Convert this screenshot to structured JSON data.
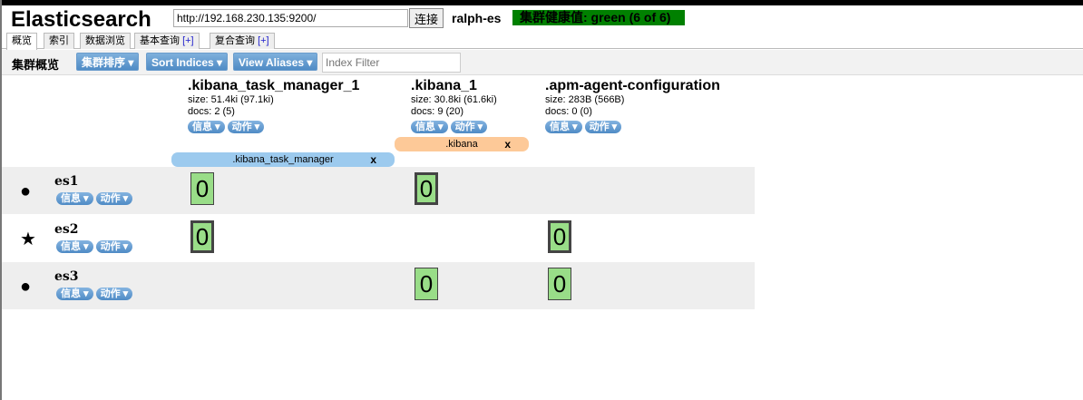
{
  "header": {
    "title": "Elasticsearch",
    "url": "http://192.168.230.135:9200/",
    "connect": "连接",
    "cluster_name": "ralph-es",
    "health": "集群健康值: green (6 of 6)",
    "health_color": "#008000"
  },
  "tabs": [
    {
      "label": "概览",
      "plus": ""
    },
    {
      "label": "索引",
      "plus": ""
    },
    {
      "label": "数据浏览",
      "plus": ""
    },
    {
      "label": "基本查询 ",
      "plus": "[+]"
    },
    {
      "label": "复合查询 ",
      "plus": "[+]"
    }
  ],
  "toolbar": {
    "title": "集群概览",
    "sort_cluster": "集群排序 ▾",
    "sort_indices": "Sort Indices ▾",
    "view_aliases": "View Aliases ▾",
    "filter_placeholder": "Index Filter"
  },
  "buttons": {
    "info": "信息 ▾",
    "action": "动作 ▾"
  },
  "indices": [
    {
      "name": ".kibana_task_manager_1",
      "size": "size: 51.4ki (97.1ki)",
      "docs": "docs: 2 (5)",
      "alias": ".kibana_task_manager",
      "x": "x"
    },
    {
      "name": ".kibana_1",
      "size": "size: 30.8ki (61.6ki)",
      "docs": "docs: 9 (20)",
      "alias": ".kibana",
      "x": "x"
    },
    {
      "name": ".apm-agent-configuration",
      "size": "size: 283B (566B)",
      "docs": "docs: 0 (0)"
    }
  ],
  "nodes": [
    {
      "name": "es1",
      "icon": "●",
      "shards": [
        {
          "i": 0,
          "n": "0",
          "primary": false
        },
        {
          "i": 1,
          "n": "0",
          "primary": true
        }
      ]
    },
    {
      "name": "es2",
      "icon": "★",
      "shards": [
        {
          "i": 0,
          "n": "0",
          "primary": true
        },
        {
          "i": 2,
          "n": "0",
          "primary": true
        }
      ]
    },
    {
      "name": "es3",
      "icon": "●",
      "shards": [
        {
          "i": 1,
          "n": "0",
          "primary": false
        },
        {
          "i": 2,
          "n": "0",
          "primary": false
        }
      ]
    }
  ]
}
